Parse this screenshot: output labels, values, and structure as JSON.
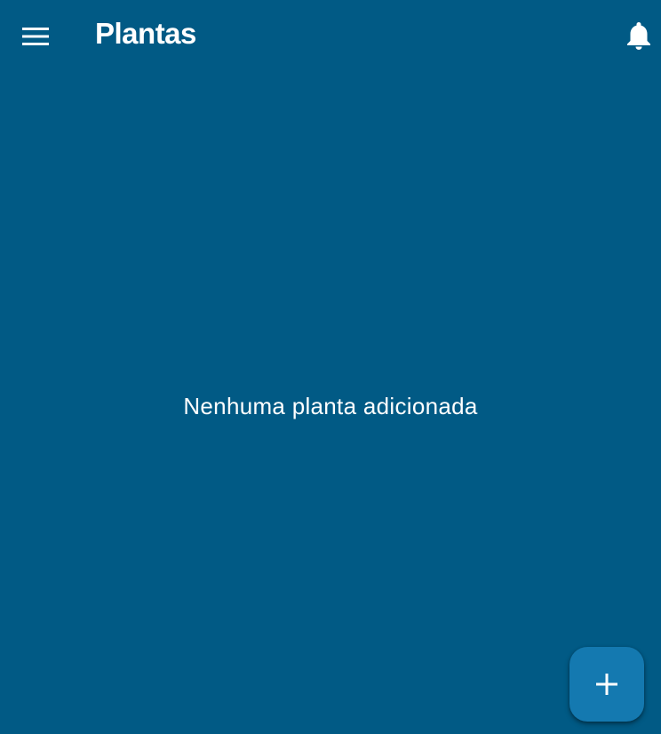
{
  "app_bar": {
    "title": "Plantas",
    "menu_icon": "hamburger-menu-icon",
    "notifications_icon": "bell-icon"
  },
  "main": {
    "empty_message": "Nenhuma planta adicionada"
  },
  "fab": {
    "icon": "plus-icon"
  },
  "colors": {
    "background": "#015a85",
    "fab": "#1479b0",
    "text": "#ffffff"
  }
}
